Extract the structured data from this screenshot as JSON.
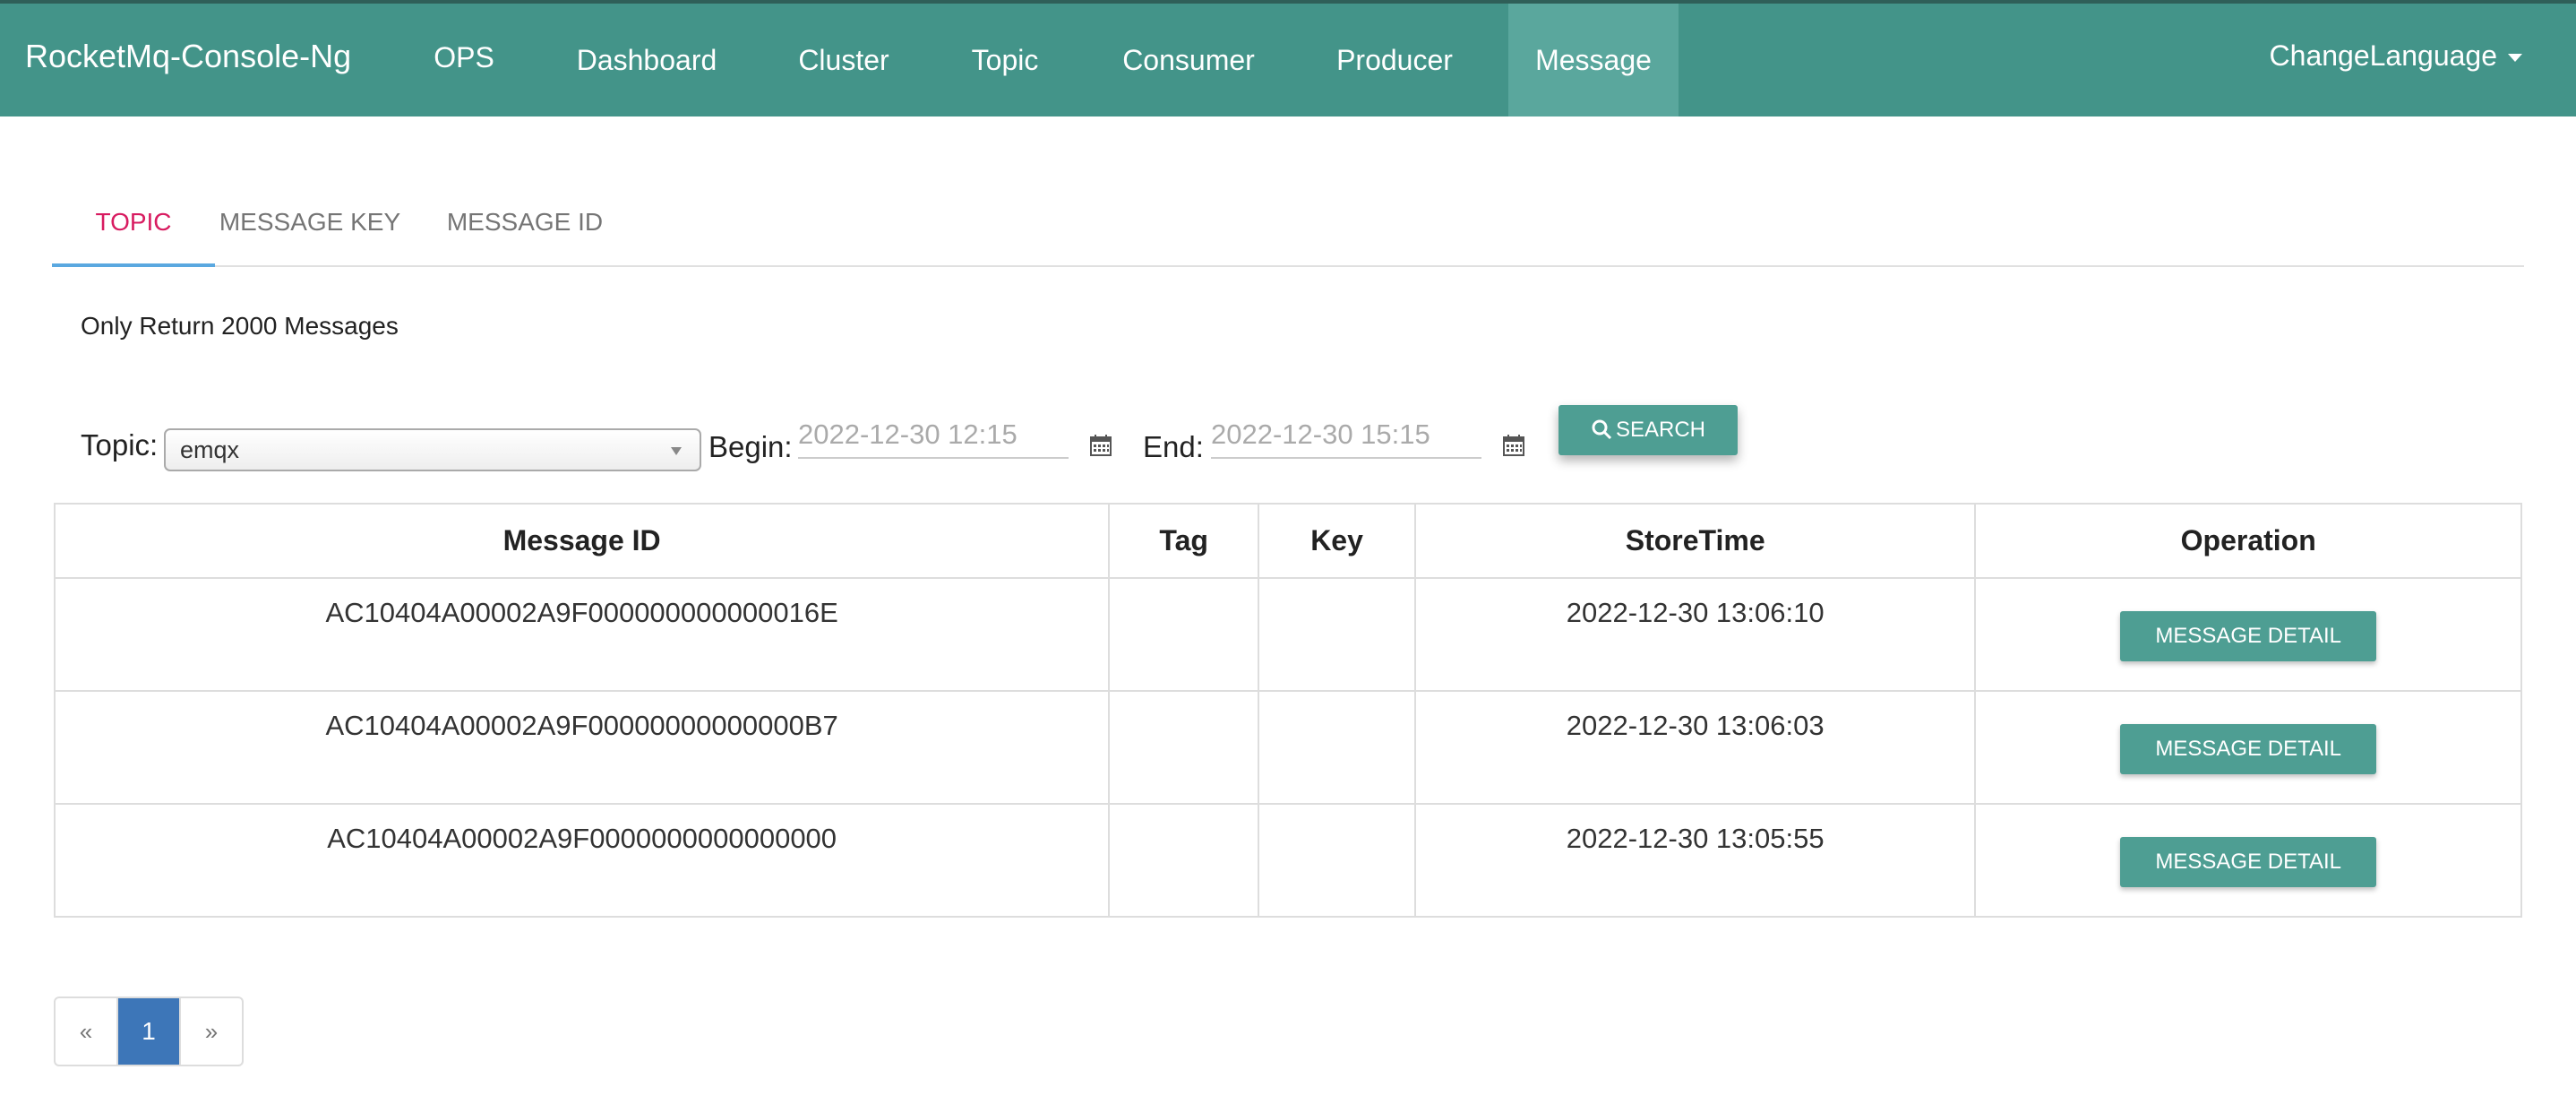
{
  "navbar": {
    "brand": "RocketMq-Console-Ng",
    "items": [
      "OPS",
      "Dashboard",
      "Cluster",
      "Topic",
      "Consumer",
      "Producer",
      "Message"
    ],
    "active": "Message",
    "lang": "ChangeLanguage"
  },
  "tabs": [
    "TOPIC",
    "MESSAGE KEY",
    "MESSAGE ID"
  ],
  "active_tab": "TOPIC",
  "notice": "Only Return 2000 Messages",
  "form": {
    "topic_label": "Topic:",
    "topic_value": "emqx",
    "begin_label": "Begin:",
    "begin_value": "2022-12-30 12:15",
    "end_label": "End:",
    "end_value": "2022-12-30 15:15",
    "search_label": "SEARCH"
  },
  "table": {
    "headers": [
      "Message ID",
      "Tag",
      "Key",
      "StoreTime",
      "Operation"
    ],
    "rows": [
      {
        "id": "AC10404A00002A9F000000000000016E",
        "tag": "",
        "key": "",
        "time": "2022-12-30 13:06:10",
        "op": "MESSAGE DETAIL"
      },
      {
        "id": "AC10404A00002A9F00000000000000B7",
        "tag": "",
        "key": "",
        "time": "2022-12-30 13:06:03",
        "op": "MESSAGE DETAIL"
      },
      {
        "id": "AC10404A00002A9F0000000000000000",
        "tag": "",
        "key": "",
        "time": "2022-12-30 13:05:55",
        "op": "MESSAGE DETAIL"
      }
    ]
  },
  "pager": {
    "prev": "«",
    "page": "1",
    "next": "»"
  },
  "colors": {
    "navbar": "#439489",
    "button": "#4e9e93",
    "active_tab": "#d81b60",
    "tab_ink": "#5aa8e0",
    "page_active": "#3d76b8"
  }
}
